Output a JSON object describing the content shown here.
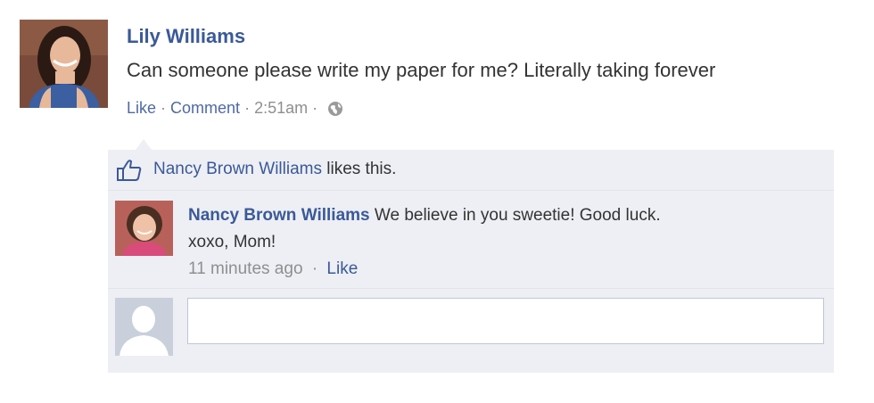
{
  "post": {
    "author": "Lily Williams",
    "text": "Can someone please write my paper for me? Literally taking forever",
    "like_label": "Like",
    "comment_label": "Comment",
    "separator": "·",
    "timestamp": "2:51am",
    "privacy_icon": "globe-icon"
  },
  "likes": {
    "icon": "thumbs-up-icon",
    "liker": "Nancy Brown Williams",
    "suffix": "likes this."
  },
  "comment": {
    "author": "Nancy Brown Williams",
    "text": "We believe in you sweetie! Good luck.",
    "text_line2": "xoxo, Mom!",
    "time": "11 minutes ago",
    "separator": "·",
    "like_label": "Like"
  },
  "reply": {
    "placeholder": "",
    "avatar_icon": "default-avatar-icon"
  },
  "colors": {
    "link": "#3b5998",
    "ufi_background": "#edeff4",
    "meta_text": "#8f8f8f"
  }
}
